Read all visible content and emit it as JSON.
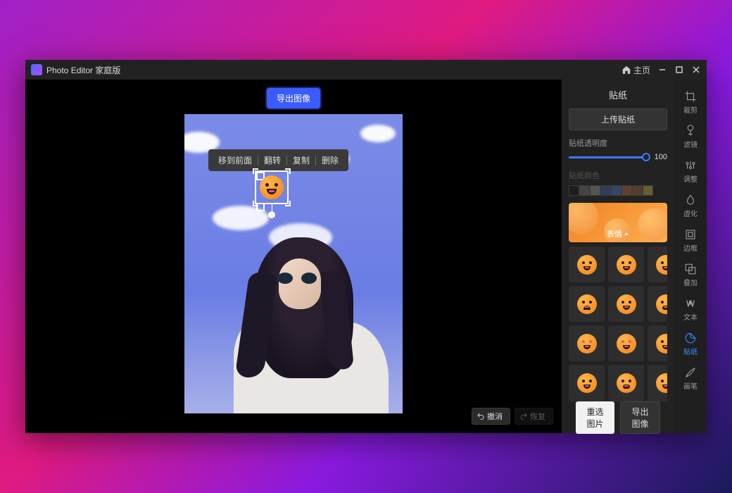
{
  "app": {
    "title": "Photo Editor 家庭版"
  },
  "titlebar": {
    "home": "主页"
  },
  "canvas": {
    "export_button": "导出图像",
    "context_menu": [
      "移到前面",
      "翻转",
      "复制",
      "删除"
    ],
    "undo": "撤消",
    "redo": "恢复"
  },
  "panel": {
    "title": "贴纸",
    "upload": "上传贴纸",
    "opacity_label": "贴纸透明度",
    "opacity_value": "100",
    "opacity_pct": 100,
    "color_label": "贴纸颜色",
    "swatches": [
      "#1a1a1a",
      "#666666",
      "#888888",
      "#3a5a9a",
      "#4a6aaa",
      "#aa5a3a",
      "#8a5a3a",
      "#aa9a3a"
    ],
    "category": "表情",
    "stickers": [
      {
        "name": "emoji-grin",
        "variant": "v1"
      },
      {
        "name": "emoji-laugh",
        "variant": "v2"
      },
      {
        "name": "emoji-smile-closed",
        "variant": "v3"
      },
      {
        "name": "emoji-content",
        "variant": "v4"
      },
      {
        "name": "emoji-smirk",
        "variant": "v5"
      },
      {
        "name": "emoji-tongue",
        "variant": "v6"
      },
      {
        "name": "emoji-kiss",
        "variant": "v7"
      },
      {
        "name": "emoji-hearts",
        "variant": "v8"
      },
      {
        "name": "emoji-whistle",
        "variant": "v9"
      },
      {
        "name": "emoji-wave",
        "variant": "v10"
      },
      {
        "name": "emoji-sweat",
        "variant": "v11"
      },
      {
        "name": "emoji-cool",
        "variant": "v12"
      }
    ]
  },
  "bottom": {
    "reselect": "重选图片",
    "export": "导出图像"
  },
  "toolrail": {
    "items": [
      {
        "name": "crop",
        "label": "裁剪"
      },
      {
        "name": "filter",
        "label": "滤镜"
      },
      {
        "name": "adjust",
        "label": "调整"
      },
      {
        "name": "blur",
        "label": "虚化"
      },
      {
        "name": "frame",
        "label": "边框"
      },
      {
        "name": "overlay",
        "label": "叠加"
      },
      {
        "name": "text",
        "label": "文本"
      },
      {
        "name": "sticker",
        "label": "贴纸"
      },
      {
        "name": "brush",
        "label": "画笔"
      }
    ],
    "active": "sticker"
  }
}
